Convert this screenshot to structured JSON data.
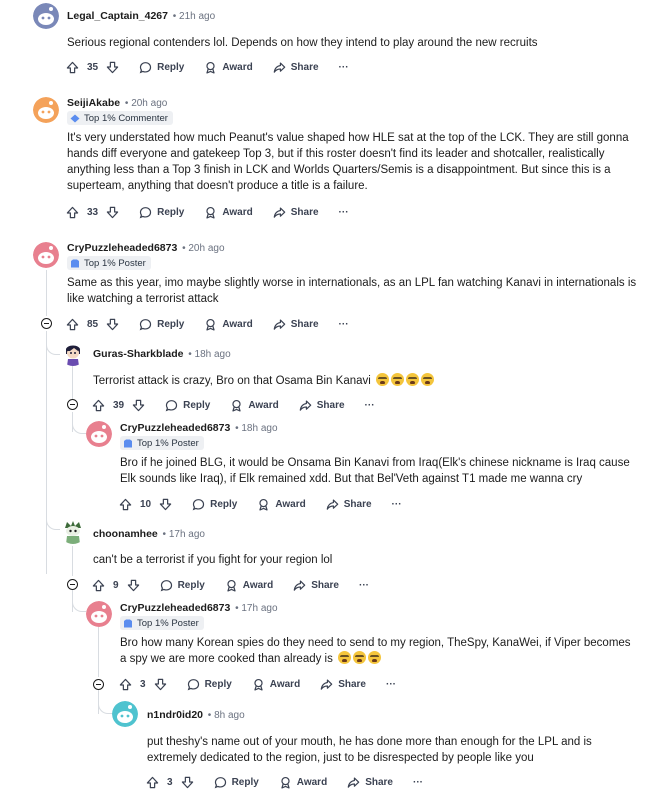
{
  "labels": {
    "reply": "Reply",
    "award": "Award",
    "share": "Share",
    "more": "···"
  },
  "colors": {
    "thread_line": "#d8dce1",
    "flair_bg": "#eef0f3",
    "text": "#1c1c1c",
    "meta": "#6b7280"
  },
  "comments": [
    {
      "author": "Legal_Captain_4267",
      "time": "21h ago",
      "flair": "",
      "text": "Serious regional contenders lol. Depends on how they intend to play around the new recruits",
      "score": "35",
      "avatar_color": "#7a88b8",
      "avatar_icon": "default-snoo-avatar"
    },
    {
      "author": "SeijiAkabe",
      "time": "20h ago",
      "flair": "Top 1% Commenter",
      "text_lines": [
        "It's very understated how much Peanut's value shaped how HLE sat at the top of the LCK. They are still gonna",
        "hands diff everyone and gatekeep Top 3, but if this roster doesn't find its leader and shotcaller, realistically",
        "anything less than a Top 3 finish in LCK and Worlds Quarters/Semis is a disappointment. But since this is a",
        "superteam, anything that doesn't produce a title is a failure."
      ],
      "score": "33",
      "avatar_color": "#f4a25a",
      "avatar_icon": "default-snoo-avatar"
    },
    {
      "author": "CryPuzzleheaded6873",
      "time": "20h ago",
      "flair": "Top 1% Poster",
      "text_lines": [
        "Same as this year, imo maybe slightly worse in internationals, as an LPL fan watching Kanavi in internationals is",
        "like watching a terrorist attack"
      ],
      "score": "85",
      "avatar_color": "#e8808f",
      "avatar_icon": "default-snoo-avatar"
    },
    {
      "author": "Guras-Sharkblade",
      "time": "18h ago",
      "flair": "",
      "text": "Terrorist attack is crazy, Bro on that Osama Bin Kanavi",
      "emoji_count": 4,
      "emoji": "crying-face-emoji",
      "score": "39",
      "avatar_color": "#2c2c54",
      "avatar_icon": "custom-snoo-avatar"
    },
    {
      "author": "CryPuzzleheaded6873",
      "time": "18h ago",
      "flair": "Top 1% Poster",
      "text_lines": [
        "Bro if he joined BLG, it would be Onsama Bin Kanavi from Iraq(Elk's chinese nickname is Iraq cause",
        "Elk sounds like Iraq), if Elk remained xdd. But that Bel'Veth against T1 made me wanna cry"
      ],
      "score": "10",
      "avatar_color": "#e8808f",
      "avatar_icon": "default-snoo-avatar"
    },
    {
      "author": "choonamhee",
      "time": "17h ago",
      "flair": "",
      "text": "can't be a terrorist if you fight for your region lol",
      "score": "9",
      "avatar_color": "#7cae7a",
      "avatar_icon": "custom-snoo-avatar"
    },
    {
      "author": "CryPuzzleheaded6873",
      "time": "17h ago",
      "flair": "Top 1% Poster",
      "text_lines": [
        "Bro how many Korean spies do they need to send to my region, TheSpy, KanaWei, if Viper becomes",
        "a spy we are more cooked than already is"
      ],
      "emoji_count": 3,
      "emoji": "crying-face-emoji",
      "score": "3",
      "avatar_color": "#e8808f",
      "avatar_icon": "default-snoo-avatar"
    },
    {
      "author": "n1ndr0id20",
      "time": "8h ago",
      "flair": "",
      "text_lines": [
        "put theshy's name out of your mouth, he has done more than enough for the LPL and is",
        "extremely dedicated to the region, just to be disrespected by people like you"
      ],
      "score": "3",
      "avatar_color": "#4fc3cf",
      "avatar_icon": "default-snoo-avatar"
    }
  ]
}
